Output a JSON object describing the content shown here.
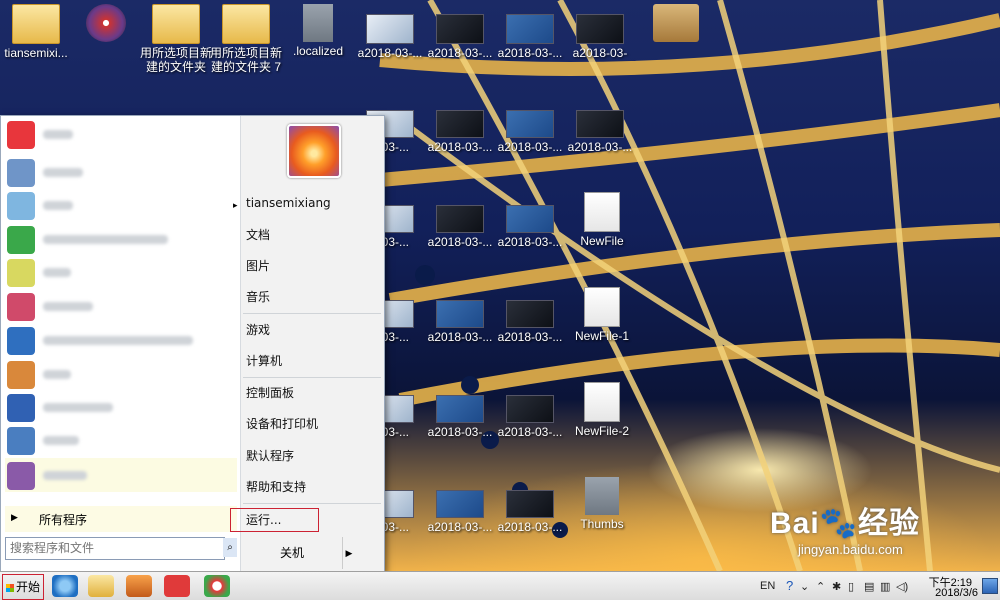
{
  "desktop": {
    "icons": [
      {
        "label": "tiansemixi...",
        "icon": "user-folder-icon"
      },
      {
        "label": "",
        "icon": "disc-shortcut-icon"
      },
      {
        "label": "用所选项目新建的文件夹",
        "icon": "folder-icon"
      },
      {
        "label": "用所选项目新建的文件夹 7",
        "icon": "folder-icon"
      },
      {
        "label": ".localized",
        "icon": "file-icon"
      },
      {
        "label": "a2018-03-...",
        "icon": "image-thumbnail-icon"
      },
      {
        "label": "a2018-03-...",
        "icon": "image-thumbnail-icon"
      },
      {
        "label": "a2018-03-...",
        "icon": "image-thumbnail-icon"
      },
      {
        "label": "a2018-03-",
        "icon": "image-thumbnail-icon"
      },
      {
        "label": "",
        "icon": "network-package-icon"
      },
      {
        "label": "3-03-...",
        "icon": "image-thumbnail-icon"
      },
      {
        "label": "a2018-03-...",
        "icon": "image-thumbnail-icon"
      },
      {
        "label": "a2018-03-...",
        "icon": "image-thumbnail-icon"
      },
      {
        "label": "a2018-03-...",
        "icon": "image-thumbnail-icon"
      },
      {
        "label": "3-03-...",
        "icon": "image-thumbnail-icon"
      },
      {
        "label": "a2018-03-...",
        "icon": "image-thumbnail-icon"
      },
      {
        "label": "a2018-03-...",
        "icon": "image-thumbnail-icon"
      },
      {
        "label": "NewFile",
        "icon": "document-icon"
      },
      {
        "label": "3-03-...",
        "icon": "image-thumbnail-icon"
      },
      {
        "label": "a2018-03-...",
        "icon": "image-thumbnail-icon"
      },
      {
        "label": "a2018-03-...",
        "icon": "image-thumbnail-icon"
      },
      {
        "label": "NewFile-1",
        "icon": "document-icon"
      },
      {
        "label": "3-03-...",
        "icon": "image-thumbnail-icon"
      },
      {
        "label": "a2018-03-...",
        "icon": "image-thumbnail-icon"
      },
      {
        "label": "a2018-03-...",
        "icon": "image-thumbnail-icon"
      },
      {
        "label": "NewFile-2",
        "icon": "document-icon"
      },
      {
        "label": "3-03-...",
        "icon": "image-thumbnail-icon"
      },
      {
        "label": "a2018-03-...",
        "icon": "image-thumbnail-icon"
      },
      {
        "label": "a2018-03-...",
        "icon": "image-thumbnail-icon"
      },
      {
        "label": "Thumbs",
        "icon": "thumbs-file-icon"
      }
    ]
  },
  "start_menu": {
    "pinned_programs": [
      {
        "icon": "media-player-red-icon",
        "color": "#e8363c"
      },
      {
        "icon": "calculator-icon",
        "color": "#6f95c8"
      },
      {
        "icon": "sticky-app-icon",
        "color": "#7fb6e0"
      },
      {
        "icon": "windows-media-center-icon",
        "color": "#3aa84a"
      },
      {
        "icon": "sticky-notes-icon",
        "color": "#d8d860"
      },
      {
        "icon": "snipping-tool-icon",
        "color": "#d04a6a"
      },
      {
        "icon": "internet-download-manager-icon",
        "color": "#2f6fbf"
      },
      {
        "icon": "paint-icon",
        "color": "#d9883b"
      },
      {
        "icon": "remote-desktop-icon",
        "color": "#3061b3"
      },
      {
        "icon": "magnifier-icon",
        "color": "#4a7ec0"
      },
      {
        "icon": "dvd-maker-icon",
        "color": "#8a5aa8"
      }
    ],
    "all_programs": "所有程序",
    "search_placeholder": "搜索程序和文件",
    "right_items": {
      "user": "tiansemixiang",
      "documents": "文档",
      "pictures": "图片",
      "music": "音乐",
      "games": "游戏",
      "computer": "计算机",
      "control_panel": "控制面板",
      "devices_printers": "设备和打印机",
      "default_programs": "默认程序",
      "help_support": "帮助和支持",
      "run": "运行..."
    },
    "shutdown": "关机"
  },
  "taskbar": {
    "start": "开始",
    "language": "EN",
    "time": "下午2:19",
    "date": "2018/3/6"
  },
  "watermark": {
    "brand": "Bai",
    "brand_cn": "经验",
    "url": "jingyan.baidu.com"
  }
}
